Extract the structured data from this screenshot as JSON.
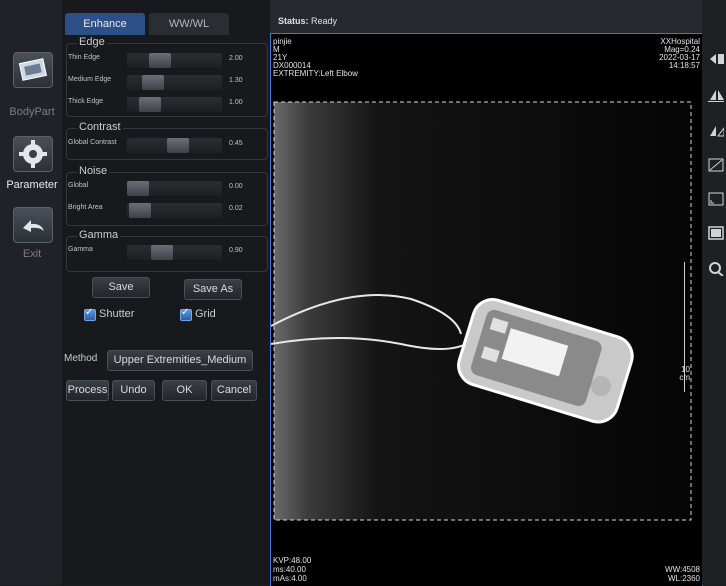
{
  "sidebar": {
    "items": [
      {
        "label": "BodyPart",
        "icon": "body-part-icon"
      },
      {
        "label": "Parameter",
        "icon": "gear-icon"
      },
      {
        "label": "Exit",
        "icon": "return-arrow-icon"
      }
    ]
  },
  "panel": {
    "tabs": [
      {
        "label": "Enhance",
        "active": true
      },
      {
        "label": "WW/WL",
        "active": false
      }
    ],
    "edge": {
      "title": "Edge",
      "sliders": [
        {
          "label": "Thin Edge",
          "value": "2.00"
        },
        {
          "label": "Medium Edge",
          "value": "1.30"
        },
        {
          "label": "Thick Edge",
          "value": "1.00"
        }
      ]
    },
    "contrast": {
      "title": "Contrast",
      "sliders": [
        {
          "label": "Global Contrast",
          "value": "0.45"
        }
      ]
    },
    "noise": {
      "title": "Noise",
      "sliders": [
        {
          "label": "Global",
          "value": "0.00"
        },
        {
          "label": "Bright Area",
          "value": "0.02"
        }
      ]
    },
    "gamma": {
      "title": "Gamma",
      "sliders": [
        {
          "label": "Gamma",
          "value": "0.90"
        }
      ]
    },
    "save_label": "Save",
    "save_as_label": "Save As",
    "shutter_label": "Shutter",
    "shutter_checked": true,
    "grid_label": "Grid",
    "grid_checked": true,
    "method_label": "Method",
    "method_value": "Upper Extremities_Medium",
    "actions": {
      "process": "Process",
      "undo": "Undo",
      "ok": "OK",
      "cancel": "Cancel"
    }
  },
  "status": {
    "label": "Status:",
    "value": "Ready"
  },
  "overlay": {
    "patient_name": "pinjie",
    "sex": "M",
    "age": "21Y",
    "id": "DX000014",
    "exam": "EXTREMITY:Left Elbow",
    "hospital": "XXHospital",
    "mag": "Mag=0.24",
    "date": "2022-03-17",
    "time": "14:18:57",
    "kvp": "KVP:48.00",
    "ms": "ms:40.00",
    "mas": "mAs:4.00",
    "ww": "WW:4508",
    "wl": "WL:2360",
    "scale_value": "10",
    "scale_unit": "cm"
  },
  "colors": {
    "accent": "#3a7bd5",
    "checkbox": "#3f82d6",
    "tab_active": "#2b4f86"
  }
}
